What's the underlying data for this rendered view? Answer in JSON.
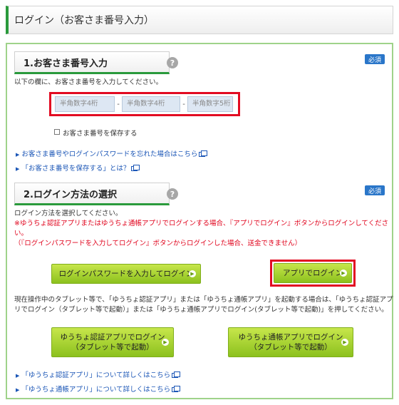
{
  "page_title": "ログイン（お客さま番号入力）",
  "section1": {
    "heading": "1.お客さま番号入力",
    "required_badge": "必須",
    "help": "?",
    "instruction": "以下の欄に、お客さま番号を入力してください。",
    "inputs": [
      {
        "placeholder": "半角数字4桁"
      },
      {
        "placeholder": "半角数字4桁"
      },
      {
        "placeholder": "半角数字5桁"
      }
    ],
    "separator": "-",
    "save_checkbox_label": "お客さま番号を保存する",
    "links": [
      "お客さま番号やログインパスワードを忘れた場合はこちら",
      "「お客さま番号を保存する」とは？"
    ]
  },
  "section2": {
    "heading": "2.ログイン方法の選択",
    "required_badge": "必須",
    "help": "?",
    "instruction": "ログイン方法を選択してください。",
    "warning_line1": "※ゆうちょ認証アプリまたはゆうちょ通帳アプリでログインする場合、『アプリでログイン』ボタンからログインしてくださ",
    "warning_line2": "い。",
    "warning_note": "（『ログインパスワードを入力してログイン』ボタンからログインした場合、送金できません）",
    "btn_password_login": "ログインパスワードを入力してログイン",
    "btn_app_login": "アプリでログイン",
    "tablet_note_line1": "現在操作中のタブレット等で、「ゆうちょ認証アプリ」または「ゆうちょ通帳アプリ」を起動する場合は、「ゆうちょ認証アプ",
    "tablet_note_line2": "リでログイン（タブレット等で起動）」または「ゆうちょ通帳アプリでログイン(タブレット等で起動)」を押してください。",
    "btn_auth_app_line1": "ゆうちょ認証アプリでログイン",
    "btn_auth_app_line2": "（タブレット等で起動）",
    "btn_passbook_app_line1": "ゆうちょ通帳アプリでログイン",
    "btn_passbook_app_line2": "（タブレット等で起動）",
    "links": [
      "「ゆうちょ認証アプリ」について詳しくはこちら",
      "「ゆうちょ通帳アプリ」について詳しくはこちら"
    ]
  },
  "colors": {
    "accent_green": "#2a9a3c",
    "button_green": "#9ccd2a",
    "highlight_red": "#e20b22",
    "badge_blue": "#2a76c9",
    "link_blue": "#1a55b6"
  }
}
